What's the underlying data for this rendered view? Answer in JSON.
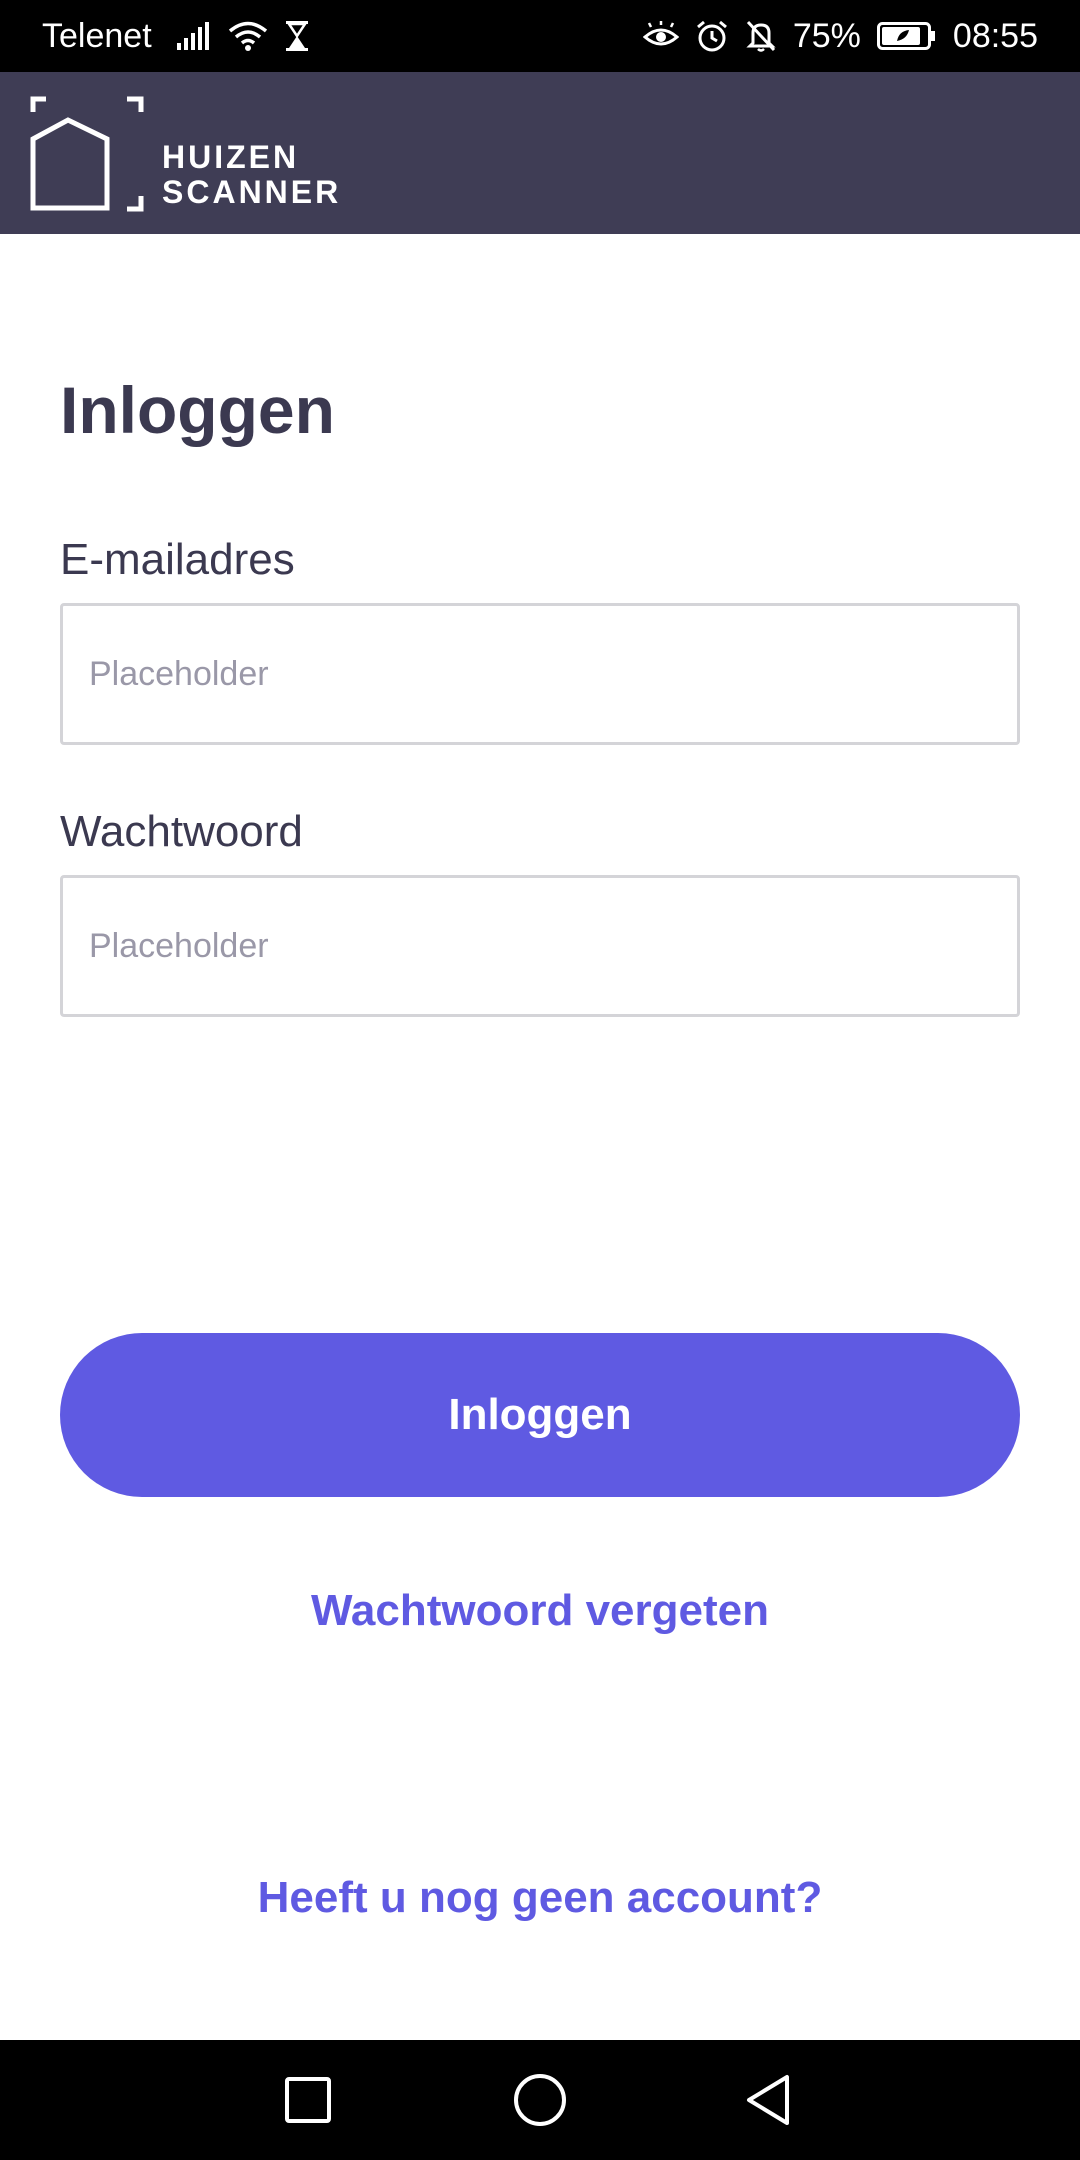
{
  "status_bar": {
    "carrier": "Telenet",
    "battery": "75%",
    "time": "08:55",
    "icons": [
      "signal-icon",
      "wifi-icon",
      "hourglass-icon",
      "eye-icon",
      "alarm-icon",
      "bell-off-icon",
      "battery-icon"
    ]
  },
  "header": {
    "logo_line1": "HUIZEN",
    "logo_line2": "SCANNER"
  },
  "form": {
    "title": "Inloggen",
    "email_label": "E-mailadres",
    "email_placeholder": "Placeholder",
    "email_value": "",
    "password_label": "Wachtwoord",
    "password_placeholder": "Placeholder",
    "password_value": "",
    "submit_label": "Inloggen",
    "forgot_link": "Wachtwoord vergeten",
    "signup_link": "Heeft u nog geen account?"
  },
  "nav_bar": {
    "buttons": [
      "recents-icon",
      "home-icon",
      "back-icon"
    ]
  },
  "colors": {
    "header_bg": "#3f3d55",
    "accent": "#5f5ae2",
    "text": "#3b3950"
  }
}
